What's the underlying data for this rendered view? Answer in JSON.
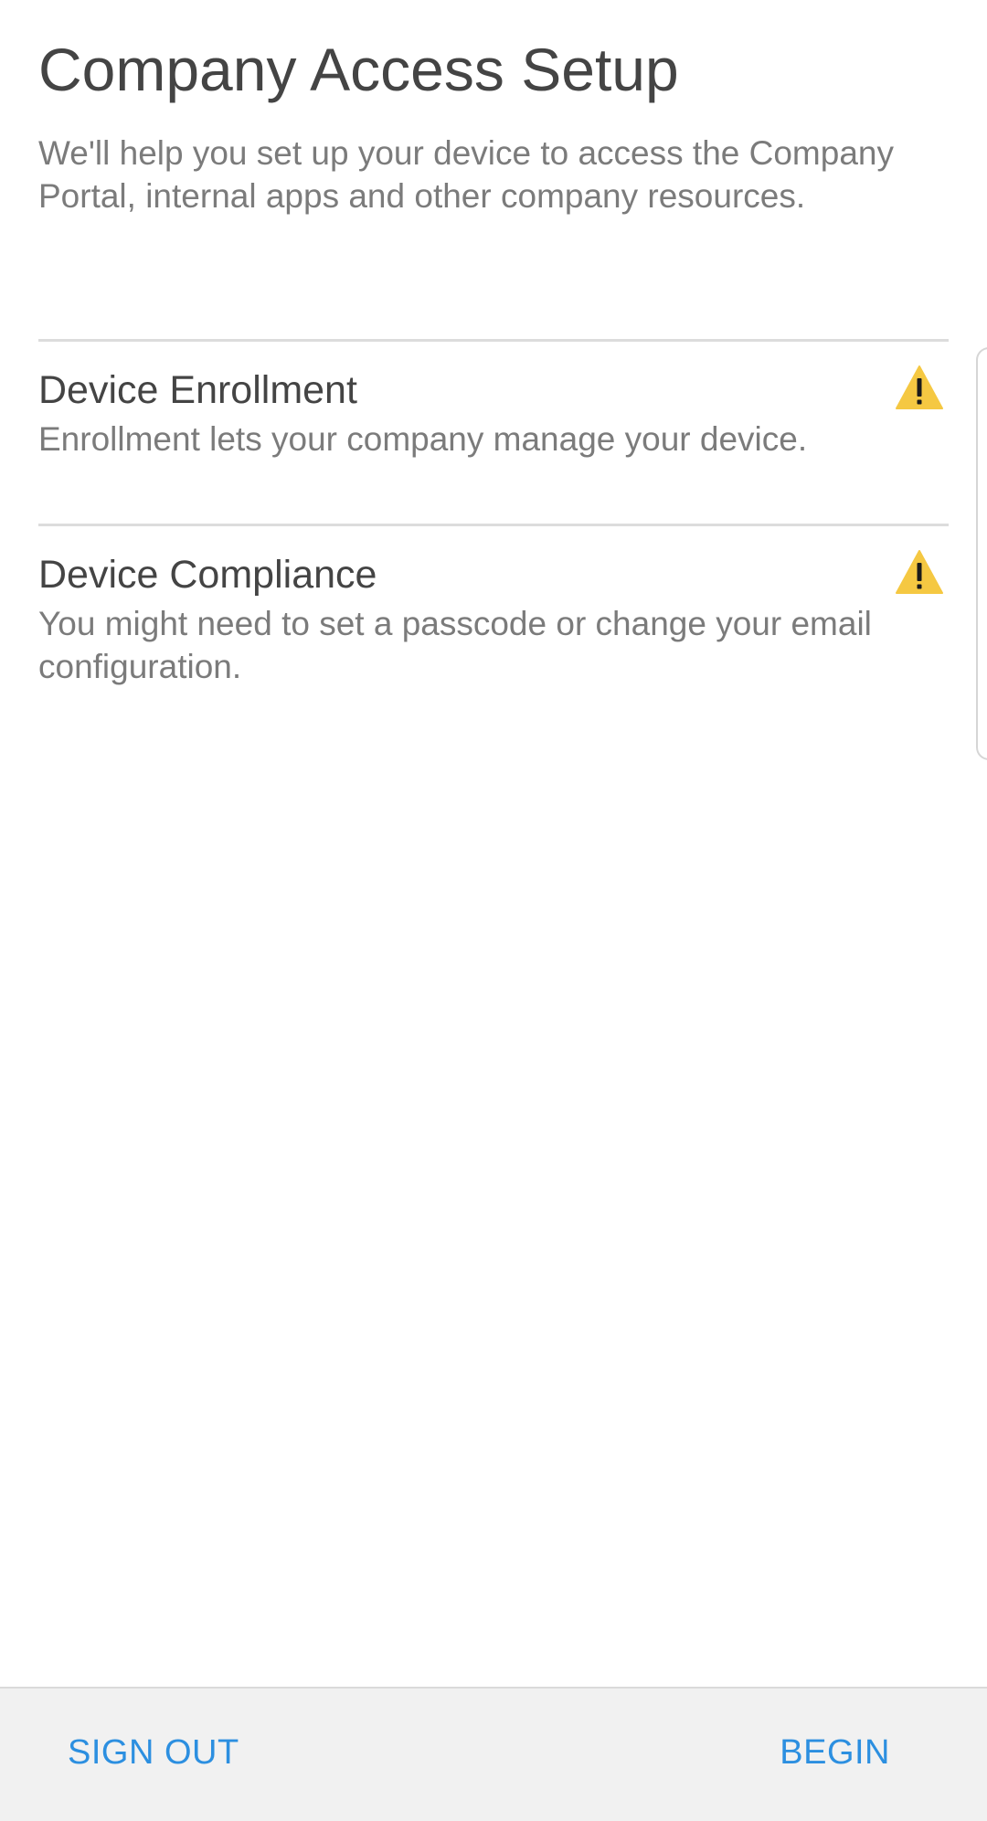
{
  "header": {
    "title": "Company Access Setup",
    "description": "We'll help you set up your device to access the Company Portal, internal apps and other company resources."
  },
  "steps": [
    {
      "title": "Device Enrollment",
      "description": "Enrollment lets your company manage your device.",
      "icon": "warning-icon",
      "status_color": "#F5C842"
    },
    {
      "title": "Device Compliance",
      "description": "You might need to set a passcode or change your email configuration.",
      "icon": "warning-icon",
      "status_color": "#F5C842"
    }
  ],
  "footer": {
    "sign_out_label": "SIGN OUT",
    "begin_label": "BEGIN"
  },
  "colors": {
    "accent": "#2C8FE0",
    "warning": "#F5C842",
    "title_text": "#444444",
    "body_text": "#7B7B7B"
  }
}
